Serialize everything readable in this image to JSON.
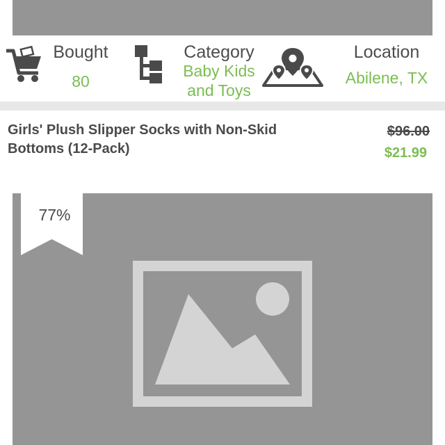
{
  "stats": {
    "bought": {
      "title": "Bought",
      "value": "80",
      "icon": "cart-icon"
    },
    "category": {
      "title": "Category",
      "value_line1": "Baby Kids",
      "value_line2": "and Toys",
      "icon": "hierarchy-icon"
    },
    "location": {
      "title": "Location",
      "value": "Abilene, TX",
      "icon": "map-pins-icon"
    }
  },
  "deal": {
    "title_line1": "Girls' Plush Slipper Socks with Non-Skid",
    "title_line2": "Bottoms (12-Pack)",
    "original_price": "$96.00",
    "sale_price": "$21.99",
    "discount": "77%"
  },
  "colors": {
    "accent_green": "#7bbd52",
    "text_dark": "#4a4a4a",
    "image_placeholder": "#959595",
    "divider": "#e8e8e8"
  }
}
